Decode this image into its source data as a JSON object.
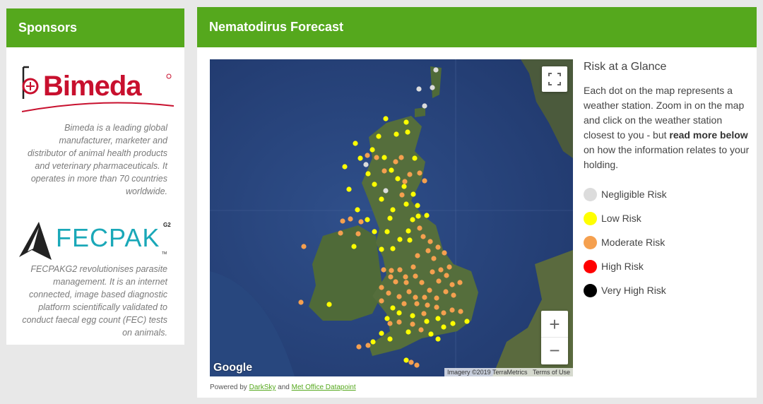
{
  "sponsors": {
    "title": "Sponsors",
    "bimeda": {
      "logo_text": "Bimeda",
      "description": "Bimeda is a leading global manufacturer, marketer and distributor of animal health products and veterinary pharmaceuticals. It operates in more than 70 countries worldwide."
    },
    "fecpak": {
      "logo_text": "FECPAK",
      "logo_sup": "G2",
      "logo_tm": "TM",
      "description": "FECPAKG2 revolutionises parasite management. It is an internet connected, image based diagnostic platform scientifically validated to conduct faecal egg count (FEC) tests on animals."
    }
  },
  "forecast": {
    "title": "Nematodirus Forecast",
    "map": {
      "google_label": "Google",
      "attribution": "Imagery ©2019 TerraMetrics",
      "terms": "Terms of Use",
      "zoom_in": "+",
      "zoom_out": "−"
    },
    "powered": {
      "prefix": "Powered by",
      "darksky": "DarkSky",
      "and": "and",
      "metoffice": "Met Office Datapoint"
    },
    "glance": {
      "title": "Risk at a Glance",
      "text_before": "Each dot on the map represents a weather station. Zoom in on the map and click on the weather station closest to you - but",
      "text_bold": "read more below",
      "text_after": "on how the information relates to your holding."
    },
    "legend": [
      {
        "label": "Negligible Risk",
        "color": "#dcdcdc"
      },
      {
        "label": "Low Risk",
        "color": "#ffff00"
      },
      {
        "label": "Moderate Risk",
        "color": "#f5a04f"
      },
      {
        "label": "High Risk",
        "color": "#ff0000"
      },
      {
        "label": "Very High Risk",
        "color": "#000000"
      }
    ],
    "stations": {
      "negligible": [
        [
          617,
          99
        ],
        [
          612,
          124
        ],
        [
          593,
          126
        ],
        [
          601,
          150
        ],
        [
          518,
          233
        ],
        [
          546,
          270
        ]
      ],
      "low": [
        [
          546,
          168
        ],
        [
          575,
          173
        ],
        [
          561,
          190
        ],
        [
          503,
          203
        ],
        [
          536,
          193
        ],
        [
          577,
          187
        ],
        [
          527,
          212
        ],
        [
          488,
          236
        ],
        [
          510,
          224
        ],
        [
          544,
          223
        ],
        [
          554,
          241
        ],
        [
          494,
          268
        ],
        [
          521,
          246
        ],
        [
          587,
          224
        ],
        [
          563,
          253
        ],
        [
          530,
          261
        ],
        [
          572,
          264
        ],
        [
          540,
          282
        ],
        [
          585,
          275
        ],
        [
          556,
          297
        ],
        [
          575,
          289
        ],
        [
          591,
          291
        ],
        [
          506,
          297
        ],
        [
          520,
          311
        ],
        [
          530,
          328
        ],
        [
          552,
          309
        ],
        [
          548,
          328
        ],
        [
          578,
          327
        ],
        [
          566,
          339
        ],
        [
          592,
          306
        ],
        [
          604,
          305
        ],
        [
          580,
          340
        ],
        [
          556,
          352
        ],
        [
          501,
          349
        ],
        [
          540,
          353
        ],
        [
          584,
          311
        ],
        [
          466,
          431
        ],
        [
          556,
          436
        ],
        [
          565,
          443
        ],
        [
          548,
          451
        ],
        [
          584,
          447
        ],
        [
          604,
          455
        ],
        [
          620,
          451
        ],
        [
          628,
          463
        ],
        [
          641,
          458
        ],
        [
          661,
          455
        ],
        [
          540,
          472
        ],
        [
          552,
          480
        ],
        [
          578,
          470
        ],
        [
          528,
          484
        ],
        [
          620,
          480
        ],
        [
          610,
          473
        ],
        [
          575,
          510
        ]
      ],
      "moderate": [
        [
          568,
          223
        ],
        [
          560,
          229
        ],
        [
          544,
          242
        ],
        [
          580,
          247
        ],
        [
          533,
          223
        ],
        [
          520,
          220
        ],
        [
          573,
          257
        ],
        [
          594,
          245
        ],
        [
          601,
          256
        ],
        [
          569,
          276
        ],
        [
          485,
          313
        ],
        [
          496,
          310
        ],
        [
          482,
          330
        ],
        [
          507,
          331
        ],
        [
          511,
          314
        ],
        [
          594,
          323
        ],
        [
          599,
          335
        ],
        [
          609,
          342
        ],
        [
          620,
          350
        ],
        [
          606,
          355
        ],
        [
          629,
          358
        ],
        [
          591,
          362
        ],
        [
          614,
          366
        ],
        [
          612,
          385
        ],
        [
          624,
          382
        ],
        [
          636,
          378
        ],
        [
          585,
          378
        ],
        [
          566,
          382
        ],
        [
          554,
          383
        ],
        [
          543,
          382
        ],
        [
          574,
          392
        ],
        [
          553,
          392
        ],
        [
          540,
          407
        ],
        [
          560,
          399
        ],
        [
          575,
          400
        ],
        [
          588,
          391
        ],
        [
          597,
          400
        ],
        [
          608,
          411
        ],
        [
          621,
          398
        ],
        [
          632,
          390
        ],
        [
          640,
          403
        ],
        [
          631,
          413
        ],
        [
          651,
          400
        ],
        [
          642,
          418
        ],
        [
          618,
          422
        ],
        [
          601,
          421
        ],
        [
          588,
          421
        ],
        [
          579,
          413
        ],
        [
          565,
          420
        ],
        [
          550,
          415
        ],
        [
          540,
          426
        ],
        [
          572,
          430
        ],
        [
          590,
          430
        ],
        [
          605,
          432
        ],
        [
          618,
          435
        ],
        [
          628,
          443
        ],
        [
          640,
          439
        ],
        [
          652,
          441
        ],
        [
          600,
          444
        ],
        [
          584,
          459
        ],
        [
          565,
          456
        ],
        [
          552,
          458
        ],
        [
          596,
          467
        ],
        [
          430,
          349
        ],
        [
          426,
          428
        ],
        [
          508,
          491
        ],
        [
          521,
          489
        ],
        [
          582,
          513
        ],
        [
          590,
          517
        ]
      ],
      "high": [],
      "very_high": []
    }
  }
}
